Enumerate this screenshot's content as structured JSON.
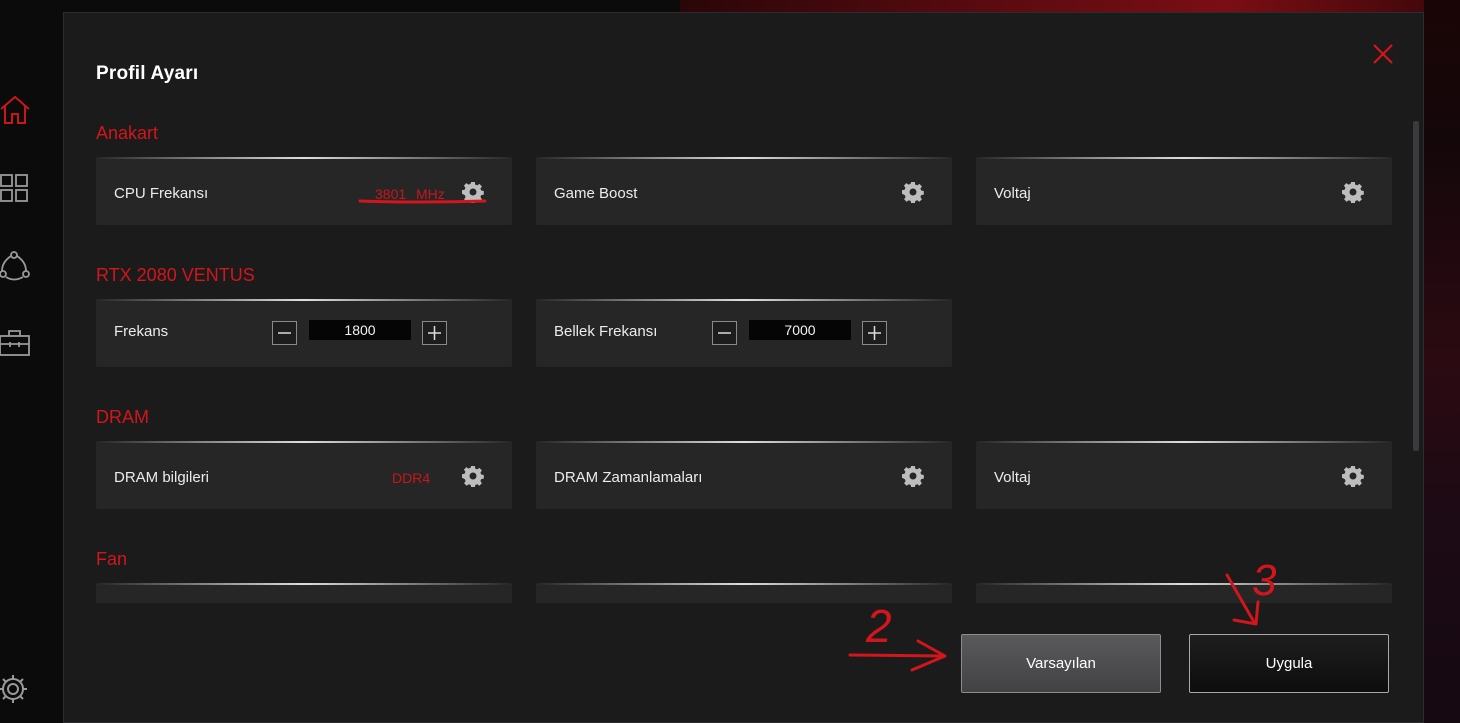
{
  "dialog": {
    "title": "Profil Ayarı"
  },
  "sections": {
    "anakart": {
      "title": "Anakart",
      "cpu_label": "CPU Frekansı",
      "cpu_value": "3801",
      "cpu_unit": "MHz",
      "game_boost_label": "Game Boost",
      "voltage_label": "Voltaj"
    },
    "gpu": {
      "title": "RTX 2080 VENTUS",
      "freq_label": "Frekans",
      "freq_value": "1800",
      "mem_freq_label": "Bellek Frekansı",
      "mem_freq_value": "7000"
    },
    "dram": {
      "title": "DRAM",
      "info_label": "DRAM bilgileri",
      "info_value": "DDR4",
      "timings_label": "DRAM Zamanlamaları",
      "voltage_label": "Voltaj"
    },
    "fan": {
      "title": "Fan"
    }
  },
  "buttons": {
    "default_label": "Varsayılan",
    "apply_label": "Uygula"
  },
  "annotations": {
    "arrow_two_number": "2",
    "arrow_three_number": "3"
  },
  "icons": {
    "rail": [
      "home-icon",
      "grid-icon",
      "share-icon",
      "toolbox-icon",
      "settings-icon"
    ],
    "card": "gear-icon",
    "close": "close-icon"
  },
  "colors": {
    "accent_red": "#d2161b",
    "dialog_bg": "#1b1b1c",
    "card_bg": "#262627"
  }
}
